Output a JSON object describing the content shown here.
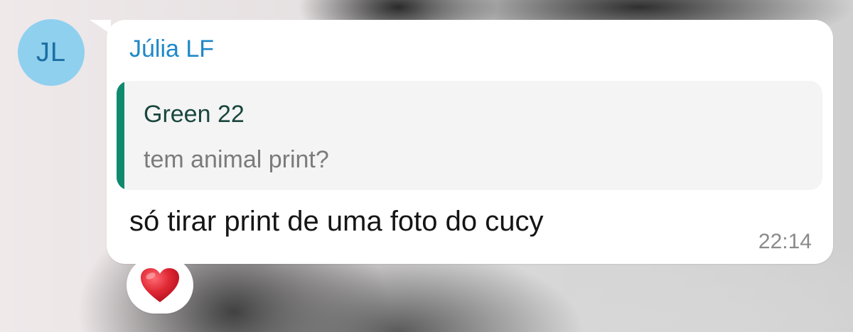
{
  "message": {
    "avatar_initials": "JL",
    "sender_name": "Júlia LF",
    "reply": {
      "author": "Green 22",
      "text": "tem animal print?"
    },
    "text": "só tirar print de uma foto do cucy",
    "time": "22:14",
    "reaction_icon": "red-heart-icon"
  },
  "colors": {
    "avatar_bg": "#8fd0ef",
    "sender_name": "#1e88c8",
    "reply_accent": "#0f8a6e",
    "reaction_heart": "#e02a36"
  }
}
